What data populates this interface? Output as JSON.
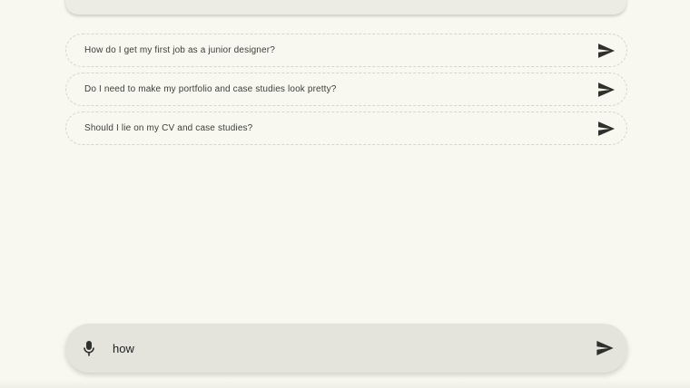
{
  "suggestions": [
    {
      "text": "How do I get my first job as a junior designer?",
      "icon": "send-icon"
    },
    {
      "text": "Do I need to make my portfolio and case studies look pretty?",
      "icon": "send-icon"
    },
    {
      "text": "Should I lie on my CV and case studies?",
      "icon": "send-icon"
    }
  ],
  "composer": {
    "value": "how",
    "mic_icon": "mic-icon",
    "send_icon": "send-icon"
  },
  "colors": {
    "background": "#f8f8f0",
    "composer_bg": "#e4e4dc",
    "icon": "#2f2f2b"
  }
}
